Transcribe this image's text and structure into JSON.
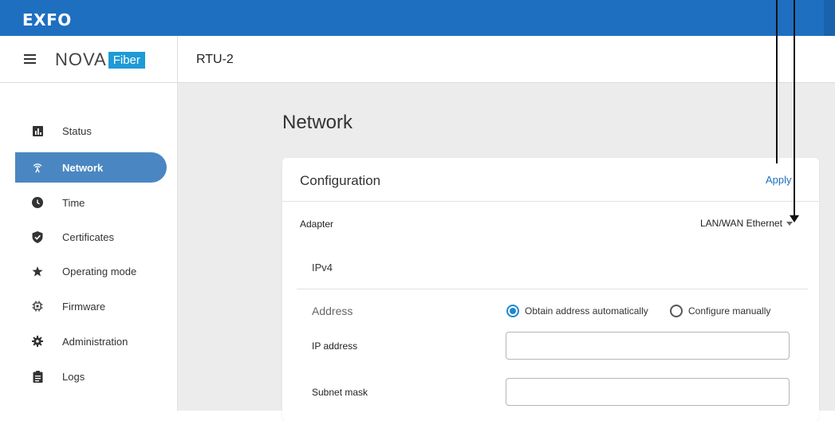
{
  "topbar": {
    "logo": "EXFO"
  },
  "appbar": {
    "brand_nova": "NOVA",
    "brand_fiber": "Fiber",
    "device_title": "RTU-2"
  },
  "sidebar": {
    "items": [
      {
        "label": "Status",
        "icon": "bar-chart-icon",
        "active": false
      },
      {
        "label": "Network",
        "icon": "wifi-antenna-icon",
        "active": true
      },
      {
        "label": "Time",
        "icon": "clock-icon",
        "active": false
      },
      {
        "label": "Certificates",
        "icon": "shield-check-icon",
        "active": false
      },
      {
        "label": "Operating mode",
        "icon": "star-icon",
        "active": false
      },
      {
        "label": "Firmware",
        "icon": "chip-icon",
        "active": false
      },
      {
        "label": "Administration",
        "icon": "gear-icon",
        "active": false
      },
      {
        "label": "Logs",
        "icon": "clipboard-icon",
        "active": false
      }
    ]
  },
  "main": {
    "page_title": "Network",
    "card": {
      "title": "Configuration",
      "apply_label": "Apply",
      "adapter_label": "Adapter",
      "adapter_value": "LAN/WAN Ethernet",
      "section_label": "IPv4",
      "address_label": "Address",
      "radio_auto": "Obtain address automatically",
      "radio_manual": "Configure manually",
      "radio_selected": "auto",
      "ip_label": "IP address",
      "ip_value": "",
      "subnet_label": "Subnet mask",
      "subnet_value": ""
    }
  },
  "colors": {
    "accent": "#1e6fc0",
    "active_nav": "#4a87c2",
    "brand_fiber": "#1f9ad6"
  }
}
